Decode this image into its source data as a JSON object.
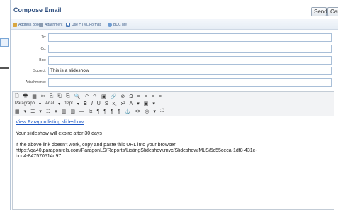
{
  "title": "Compose Email",
  "buttons": {
    "send": "Send",
    "cancel": "Cancel"
  },
  "options": {
    "address_book": "Address Book",
    "attachment": "Attachment",
    "html_format": "Use HTML Format",
    "bcc_me": "BCC Me"
  },
  "fields": {
    "to": {
      "label": "To:",
      "value": ""
    },
    "cc": {
      "label": "Cc:",
      "value": ""
    },
    "bcc": {
      "label": "Bcc:",
      "value": ""
    },
    "subject": {
      "label": "Subject:",
      "value": "This is a slideshow"
    },
    "attachments": {
      "label": "Attachments:",
      "value": ""
    }
  },
  "toolbar": {
    "row1": [
      "🗋",
      "🖶",
      "▦",
      "✂",
      "⎘",
      "⎗",
      "⎘",
      "🔍",
      "↶",
      "↷",
      "▣",
      "🔗",
      "⊘",
      "Ω",
      "≡",
      "≡",
      "≡",
      "≡"
    ],
    "paragraph": "Paragraph",
    "font": "Arial",
    "size": "12pt",
    "row2_icons": [
      "B",
      "I",
      "U",
      "S",
      "x₂",
      "x²",
      "A",
      "▾",
      "▣",
      "▾"
    ],
    "row3": [
      "▦",
      "▾",
      "☰",
      "▾",
      "☷",
      "▾",
      "▥",
      "▥",
      "—",
      "Ix",
      "¶",
      "¶",
      "¶",
      "¶",
      "⚓",
      "<>",
      "◎",
      "▾",
      "⛶"
    ]
  },
  "body": {
    "link_text": "View Paragon listing slideshow",
    "expire_text": "Your slideshow will expire after 30 days",
    "instruction_text": "If the above link doesn't work, copy and paste this URL into your browser:",
    "url_line1": "https://qa40.paragonrels.com/ParagonLS/Reports/ListingSlideshow.mvc/Slideshow/MLS/5c55ceca-1df8-431c-",
    "url_line2": "bcd4-847570514d97"
  }
}
